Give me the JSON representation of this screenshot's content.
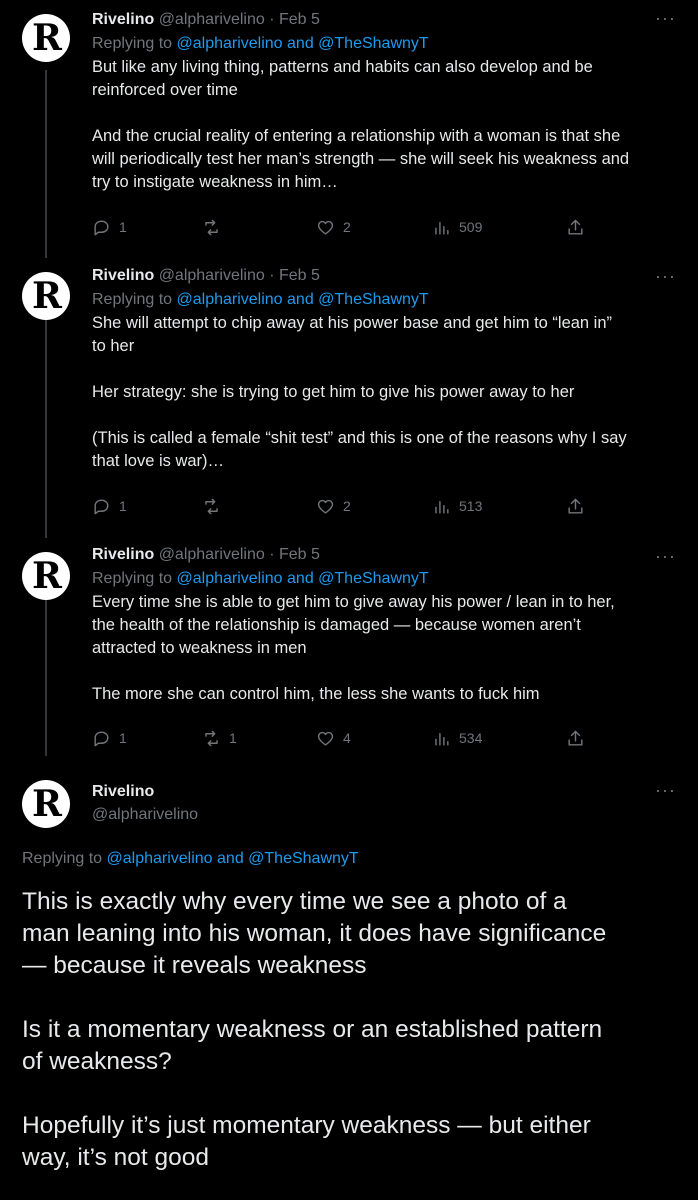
{
  "tweets": [
    {
      "avatar_letter": "R",
      "name": "Rivelino",
      "handle": "@alpharivelino",
      "separator": "·",
      "date": "Feb 5",
      "replying_prefix": "Replying to ",
      "replying_to": "@alpharivelino and @TheShawnyT",
      "more": "···",
      "lines": [
        "But like any living thing, patterns and habits can also develop and be",
        "reinforced over time",
        "",
        "And the crucial reality of entering a relationship with a woman is that she",
        "will periodically test her man’s strength — she will seek his weakness and",
        "try to instigate weakness in him…"
      ],
      "replies": "1",
      "retweets": "",
      "likes": "2",
      "views": "509"
    },
    {
      "avatar_letter": "R",
      "name": "Rivelino",
      "handle": "@alpharivelino",
      "separator": "·",
      "date": "Feb 5",
      "replying_prefix": "Replying to ",
      "replying_to": "@alpharivelino and @TheShawnyT",
      "more": "···",
      "lines": [
        "She will attempt to chip away at his power base and get him to “lean in”",
        "to her",
        "",
        "Her strategy: she is trying to get him to give his power away to her",
        "",
        "(This is called a female “shit test” and this is one of the reasons why I say",
        "that love is war)…"
      ],
      "replies": "1",
      "retweets": "",
      "likes": "2",
      "views": "513"
    },
    {
      "avatar_letter": "R",
      "name": "Rivelino",
      "handle": "@alpharivelino",
      "separator": "·",
      "date": "Feb 5",
      "replying_prefix": "Replying to ",
      "replying_to": "@alpharivelino and @TheShawnyT",
      "more": "···",
      "lines": [
        "Every time she is able to get him to give away his power / lean in to her,",
        "the health of the relationship is damaged — because women aren’t",
        "attracted to weakness in men",
        "",
        "The more she can control him, the less she wants to fuck him"
      ],
      "replies": "1",
      "retweets": "1",
      "likes": "4",
      "views": "534"
    }
  ],
  "main_tweet": {
    "avatar_letter": "R",
    "name": "Rivelino",
    "handle": "@alpharivelino",
    "more": "···",
    "replying_prefix": "Replying to ",
    "replying_to": "@alpharivelino and @TheShawnyT",
    "lines": [
      "This is exactly why every time we see a photo of a",
      "man leaning into his woman, it does have significance",
      "— because it reveals weakness",
      "",
      "Is it a momentary weakness or an established pattern",
      "of weakness?",
      "",
      "Hopefully it’s just momentary weakness — but either",
      "way, it’s not good"
    ]
  },
  "icons": [
    "reply-icon",
    "retweet-icon",
    "like-icon",
    "views-icon",
    "share-icon",
    "more-icon"
  ],
  "colors": {
    "background": "#000000",
    "text": "#e7e9ea",
    "muted": "#71767b",
    "link": "#1d9bf0",
    "divider": "#2f3336"
  }
}
